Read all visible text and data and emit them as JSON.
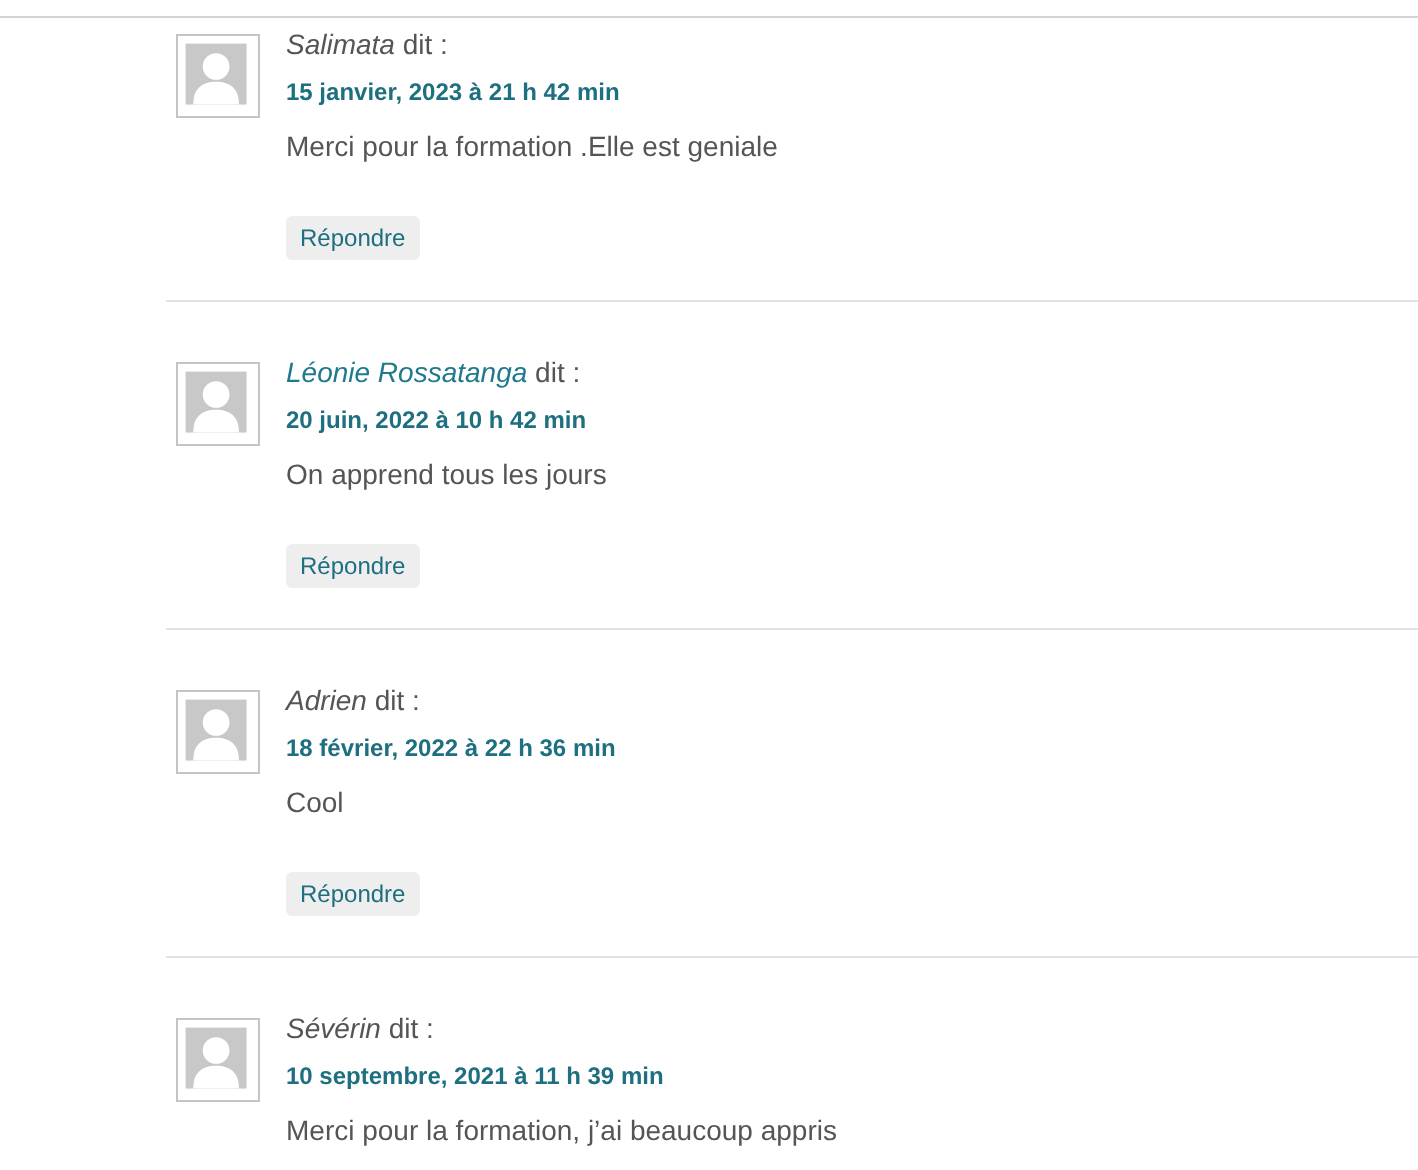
{
  "comments": [
    {
      "author": "Salimata",
      "author_linked": false,
      "says": "dit :",
      "date": "15 janvier, 2023 à 21 h 42 min",
      "text": "Merci pour la formation .Elle est geniale",
      "reply": "Répondre"
    },
    {
      "author": "Léonie Rossatanga",
      "author_linked": true,
      "says": "dit :",
      "date": "20 juin, 2022 à 10 h 42 min",
      "text": "On apprend tous les jours",
      "reply": "Répondre"
    },
    {
      "author": "Adrien",
      "author_linked": false,
      "says": "dit :",
      "date": "18 février, 2022 à 22 h 36 min",
      "text": "Cool",
      "reply": "Répondre"
    },
    {
      "author": "Sévérin",
      "author_linked": false,
      "says": "dit :",
      "date": "10 septembre, 2021 à 11 h 39 min",
      "text": "Merci pour la formation, j’ai beaucoup appris"
    }
  ]
}
